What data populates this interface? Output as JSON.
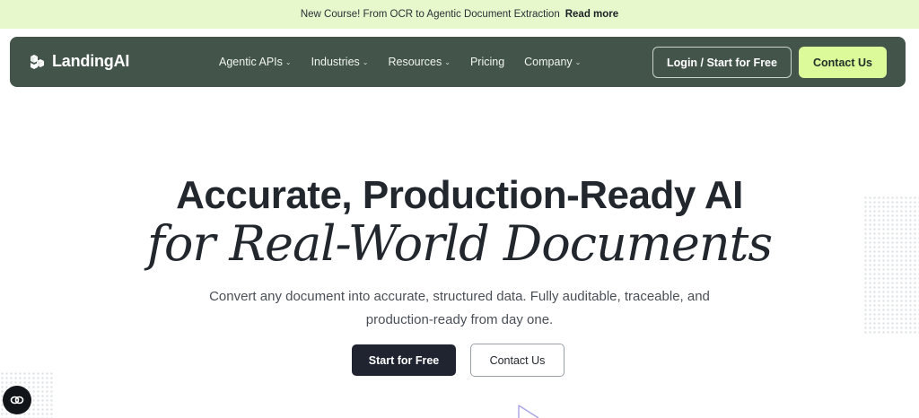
{
  "announcement": {
    "text": "New Course! From OCR to Agentic Document Extraction",
    "link": "Read more"
  },
  "brand": {
    "name": "LandingAI"
  },
  "nav": {
    "items": [
      {
        "label": "Agentic APIs",
        "has_dropdown": true
      },
      {
        "label": "Industries",
        "has_dropdown": true
      },
      {
        "label": "Resources",
        "has_dropdown": true
      },
      {
        "label": "Pricing",
        "has_dropdown": false
      },
      {
        "label": "Company",
        "has_dropdown": true
      }
    ],
    "login_label": "Login / Start for Free",
    "contact_label": "Contact Us"
  },
  "hero": {
    "title": "Accurate, Production-Ready AI",
    "title_italic": "for Real-World Documents",
    "subtitle": "Convert any document into accurate, structured data. Fully auditable, traceable, and production-ready from day one.",
    "primary_cta": "Start for Free",
    "secondary_cta": "Contact Us"
  },
  "icons": {
    "logo": "stacked-blocks-icon",
    "dropdown": "chevron-down-icon",
    "chat": "chat-bubble-icon"
  },
  "colors": {
    "announcement_bg": "#e7f8cd",
    "nav_bg": "#43554b",
    "accent_lime": "#dcfa9a",
    "primary_dark": "#1f2430"
  }
}
